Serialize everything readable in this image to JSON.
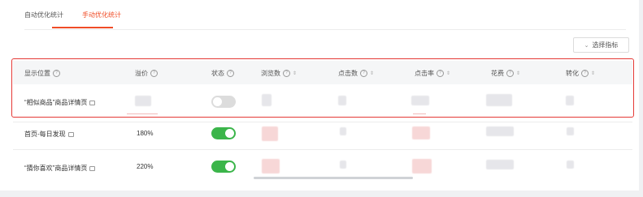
{
  "tabs": [
    {
      "label": "自动优化统计",
      "active": false
    },
    {
      "label": "手动优化统计",
      "active": true
    }
  ],
  "toolbar": {
    "select_metrics_label": "选择指标"
  },
  "table": {
    "columns": [
      {
        "label": "显示位置",
        "help": true,
        "sortable": false
      },
      {
        "label": "溢价",
        "help": true,
        "sortable": false
      },
      {
        "label": "状态",
        "help": true,
        "sortable": false
      },
      {
        "label": "浏览数",
        "help": true,
        "sortable": true
      },
      {
        "label": "点击数",
        "help": true,
        "sortable": true
      },
      {
        "label": "点击率",
        "help": true,
        "sortable": true
      },
      {
        "label": "花费",
        "help": true,
        "sortable": true
      },
      {
        "label": "转化",
        "help": true,
        "sortable": true
      }
    ],
    "rows": [
      {
        "position": "“相似商品”商品详情页",
        "premium": "",
        "status_on": false
      },
      {
        "position": "首页-每日发现",
        "premium": "180%",
        "status_on": true
      },
      {
        "position": "“猜你喜欢”商品详情页",
        "premium": "220%",
        "status_on": true
      }
    ]
  },
  "colors": {
    "accent": "#f04c26",
    "highlight": "#e53935",
    "toggle_on": "#3bb54a"
  }
}
